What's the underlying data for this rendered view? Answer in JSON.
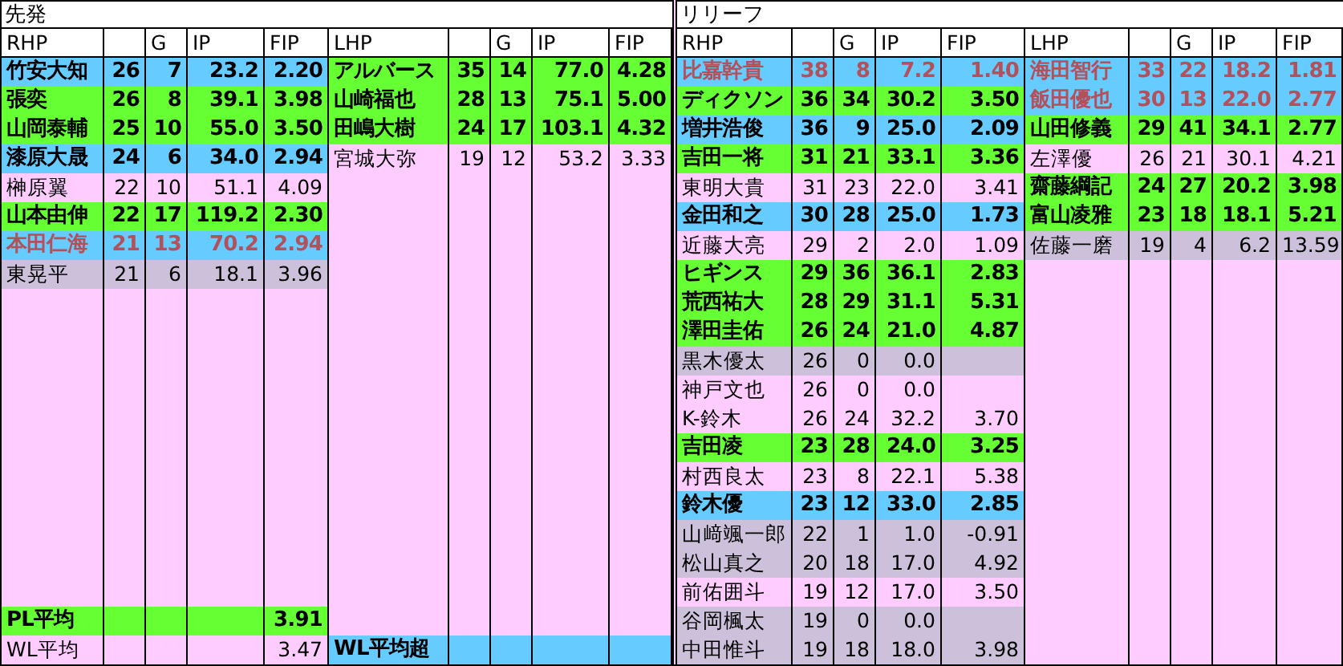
{
  "panels": [
    {
      "title": "先発",
      "groups": [
        {
          "header": {
            "name": "RHP",
            "g": "G",
            "ip": "IP",
            "fip": "FIP"
          },
          "rows": [
            {
              "name": "竹安大知",
              "column_2": "26",
              "g": "7",
              "ip": "23.2",
              "fip": "2.20",
              "kind": "blue",
              "highlighted": false
            },
            {
              "name": "張奕",
              "column_2": "26",
              "g": "8",
              "ip": "39.1",
              "fip": "3.98",
              "kind": "green",
              "highlighted": false
            },
            {
              "name": "山岡泰輔",
              "column_2": "25",
              "g": "10",
              "ip": "55.0",
              "fip": "3.50",
              "kind": "green",
              "highlighted": false
            },
            {
              "name": "漆原大晟",
              "column_2": "24",
              "g": "6",
              "ip": "34.0",
              "fip": "2.94",
              "kind": "blue",
              "highlighted": false
            },
            {
              "name": "榊原翼",
              "column_2": "22",
              "g": "10",
              "ip": "51.1",
              "fip": "4.09",
              "kind": "plain",
              "highlighted": false
            },
            {
              "name": "山本由伸",
              "column_2": "22",
              "g": "17",
              "ip": "119.2",
              "fip": "2.30",
              "kind": "green",
              "highlighted": false
            },
            {
              "name": "本田仁海",
              "column_2": "21",
              "g": "13",
              "ip": "70.2",
              "fip": "2.94",
              "kind": "blue",
              "highlighted": true
            },
            {
              "name": "東晃平",
              "column_2": "21",
              "g": "6",
              "ip": "18.1",
              "fip": "3.96",
              "kind": "gray",
              "highlighted": false
            }
          ],
          "footer": [
            {
              "name": "PL平均",
              "fip": "3.91",
              "kind": "green",
              "highlighted": false
            },
            {
              "name": "WL平均",
              "fip": "3.47",
              "kind": "plain",
              "highlighted": false
            }
          ]
        },
        {
          "header": {
            "name": "LHP",
            "g": "G",
            "ip": "IP",
            "fip": "FIP"
          },
          "rows": [
            {
              "name": "アルバース",
              "column_2": "35",
              "g": "14",
              "ip": "77.0",
              "fip": "4.28",
              "kind": "green",
              "highlighted": false
            },
            {
              "name": "山崎福也",
              "column_2": "28",
              "g": "13",
              "ip": "75.1",
              "fip": "5.00",
              "kind": "green",
              "highlighted": false
            },
            {
              "name": "田嶋大樹",
              "column_2": "24",
              "g": "17",
              "ip": "103.1",
              "fip": "4.32",
              "kind": "green",
              "highlighted": false
            },
            {
              "name": "宮城大弥",
              "column_2": "19",
              "g": "12",
              "ip": "53.2",
              "fip": "3.33",
              "kind": "plain",
              "highlighted": false
            }
          ],
          "footer": [
            {
              "name": "WL平均超",
              "kind": "blue",
              "highlighted": false
            }
          ]
        }
      ]
    },
    {
      "title": "リリーフ",
      "groups": [
        {
          "header": {
            "name": "RHP",
            "g": "G",
            "ip": "IP",
            "fip": "FIP"
          },
          "rows": [
            {
              "name": "比嘉幹貴",
              "column_2": "38",
              "g": "8",
              "ip": "7.2",
              "fip": "1.40",
              "kind": "blue",
              "highlighted": true
            },
            {
              "name": "ディクソン",
              "column_2": "36",
              "g": "34",
              "ip": "30.2",
              "fip": "3.50",
              "kind": "green",
              "highlighted": false
            },
            {
              "name": "増井浩俊",
              "column_2": "36",
              "g": "9",
              "ip": "25.0",
              "fip": "2.09",
              "kind": "blue",
              "highlighted": false
            },
            {
              "name": "吉田一将",
              "column_2": "31",
              "g": "21",
              "ip": "33.1",
              "fip": "3.36",
              "kind": "green",
              "highlighted": false
            },
            {
              "name": "東明大貴",
              "column_2": "31",
              "g": "23",
              "ip": "22.0",
              "fip": "3.41",
              "kind": "plain",
              "highlighted": false
            },
            {
              "name": "金田和之",
              "column_2": "30",
              "g": "28",
              "ip": "25.0",
              "fip": "1.73",
              "kind": "blue",
              "highlighted": false
            },
            {
              "name": "近藤大亮",
              "column_2": "29",
              "g": "2",
              "ip": "2.0",
              "fip": "1.09",
              "kind": "plain",
              "highlighted": false
            },
            {
              "name": "ヒギンス",
              "column_2": "29",
              "g": "36",
              "ip": "36.1",
              "fip": "2.83",
              "kind": "green",
              "highlighted": false
            },
            {
              "name": "荒西祐大",
              "column_2": "28",
              "g": "29",
              "ip": "31.1",
              "fip": "5.31",
              "kind": "green",
              "highlighted": false
            },
            {
              "name": "澤田圭佑",
              "column_2": "26",
              "g": "24",
              "ip": "21.0",
              "fip": "4.87",
              "kind": "green",
              "highlighted": false
            },
            {
              "name": "黒木優太",
              "column_2": "26",
              "g": "0",
              "ip": "0.0",
              "kind": "gray",
              "highlighted": false
            },
            {
              "name": "神戸文也",
              "column_2": "26",
              "g": "0",
              "ip": "0.0",
              "kind": "plain",
              "highlighted": false
            },
            {
              "name": "K-鈴木",
              "column_2": "26",
              "g": "24",
              "ip": "32.2",
              "fip": "3.70",
              "kind": "plain",
              "highlighted": false
            },
            {
              "name": "吉田凌",
              "column_2": "23",
              "g": "28",
              "ip": "24.0",
              "fip": "3.25",
              "kind": "green",
              "highlighted": false
            },
            {
              "name": "村西良太",
              "column_2": "23",
              "g": "8",
              "ip": "22.1",
              "fip": "5.38",
              "kind": "plain",
              "highlighted": false
            },
            {
              "name": "鈴木優",
              "column_2": "23",
              "g": "12",
              "ip": "33.0",
              "fip": "2.85",
              "kind": "blue",
              "highlighted": false
            },
            {
              "name": "山﨑颯一郎",
              "column_2": "22",
              "g": "1",
              "ip": "1.0",
              "fip": "-0.91",
              "kind": "gray",
              "highlighted": false
            },
            {
              "name": "松山真之",
              "column_2": "20",
              "g": "18",
              "ip": "17.0",
              "fip": "4.92",
              "kind": "gray",
              "highlighted": false
            },
            {
              "name": "前佑囲斗",
              "column_2": "19",
              "g": "12",
              "ip": "17.0",
              "fip": "3.50",
              "kind": "plain",
              "highlighted": false
            },
            {
              "name": "谷岡楓太",
              "column_2": "19",
              "g": "0",
              "ip": "0.0",
              "kind": "gray",
              "highlighted": false
            },
            {
              "name": "中田惟斗",
              "column_2": "19",
              "g": "18",
              "ip": "18.0",
              "fip": "3.98",
              "kind": "gray",
              "highlighted": false
            }
          ]
        },
        {
          "header": {
            "name": "LHP",
            "g": "G",
            "ip": "IP",
            "fip": "FIP"
          },
          "rows": [
            {
              "name": "海田智行",
              "column_2": "33",
              "g": "22",
              "ip": "18.2",
              "fip": "1.81",
              "kind": "blue",
              "highlighted": true
            },
            {
              "name": "飯田優也",
              "column_2": "30",
              "g": "13",
              "ip": "22.0",
              "fip": "2.77",
              "kind": "blue",
              "highlighted": true
            },
            {
              "name": "山田修義",
              "column_2": "29",
              "g": "41",
              "ip": "34.1",
              "fip": "2.77",
              "kind": "green",
              "highlighted": false
            },
            {
              "name": "左澤優",
              "column_2": "26",
              "g": "21",
              "ip": "30.1",
              "fip": "4.21",
              "kind": "plain",
              "highlighted": false
            },
            {
              "name": "齋藤綱記",
              "column_2": "24",
              "g": "27",
              "ip": "20.2",
              "fip": "3.98",
              "kind": "green",
              "highlighted": false
            },
            {
              "name": "富山凌雅",
              "column_2": "23",
              "g": "18",
              "ip": "18.1",
              "fip": "5.21",
              "kind": "green",
              "highlighted": false
            },
            {
              "name": "佐藤一磨",
              "column_2": "19",
              "g": "4",
              "ip": "6.2",
              "fip": "13.59",
              "kind": "gray",
              "highlighted": false
            }
          ]
        }
      ]
    }
  ]
}
